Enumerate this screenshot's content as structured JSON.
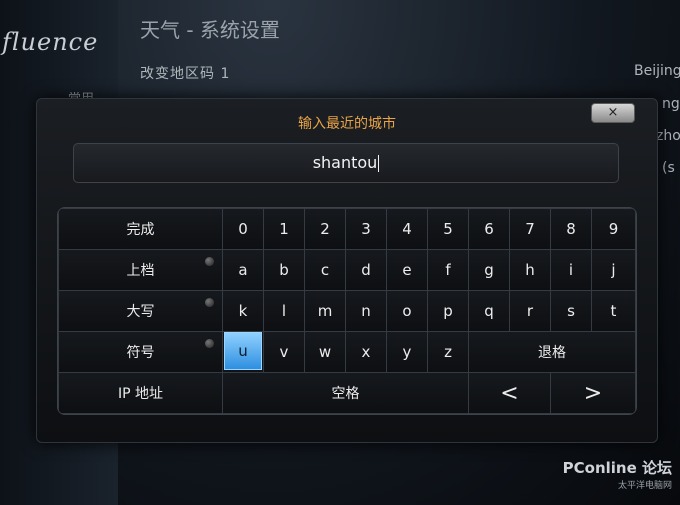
{
  "background": {
    "logo": "fluence",
    "sidebar_item": "常用",
    "header": "天气 - 系统设置",
    "row_label": "改变地区码 1",
    "row_value_1": "Beijing",
    "row_value_2": "ngha",
    "row_value_3": "zho",
    "row_value_4": "(s",
    "watermark": "PConline 论坛",
    "watermark_sub": "太平洋电脑网"
  },
  "dialog": {
    "title": "输入最近的城市",
    "close_label": "×",
    "input_value": "shantou"
  },
  "keyboard": {
    "function_keys": [
      "完成",
      "上档",
      "大写",
      "符号",
      "IP 地址"
    ],
    "row_digits": [
      "0",
      "1",
      "2",
      "3",
      "4",
      "5",
      "6",
      "7",
      "8",
      "9"
    ],
    "row_1": [
      "a",
      "b",
      "c",
      "d",
      "e",
      "f",
      "g",
      "h",
      "i",
      "j"
    ],
    "row_2": [
      "k",
      "l",
      "m",
      "n",
      "o",
      "p",
      "q",
      "r",
      "s",
      "t"
    ],
    "row_3": [
      "u",
      "v",
      "w",
      "x",
      "y",
      "z"
    ],
    "backspace": "退格",
    "space": "空格",
    "left": "<",
    "right": ">",
    "selected_key": "u"
  }
}
